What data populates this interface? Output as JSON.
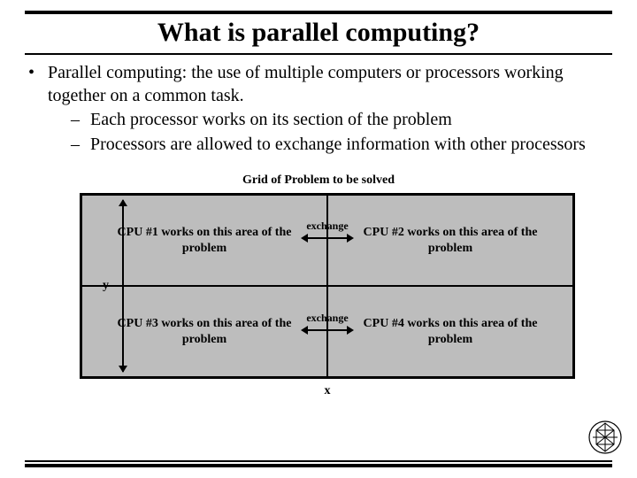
{
  "title": "What is parallel computing?",
  "bullets": {
    "l1": "Parallel computing: the use of multiple computers or processors working together on a common task.",
    "l2a": "Each processor works on its section of the problem",
    "l2b": "Processors are allowed to exchange information with other processors"
  },
  "diagram": {
    "caption": "Grid of Problem to be solved",
    "cpu1": "CPU #1 works on this area of the problem",
    "cpu2": "CPU #2 works on this area of the problem",
    "cpu3": "CPU #3 works on this area of the problem",
    "cpu4": "CPU #4 works on this area of the problem",
    "exchange": "exchange",
    "xlabel": "x",
    "ylabel": "y"
  }
}
